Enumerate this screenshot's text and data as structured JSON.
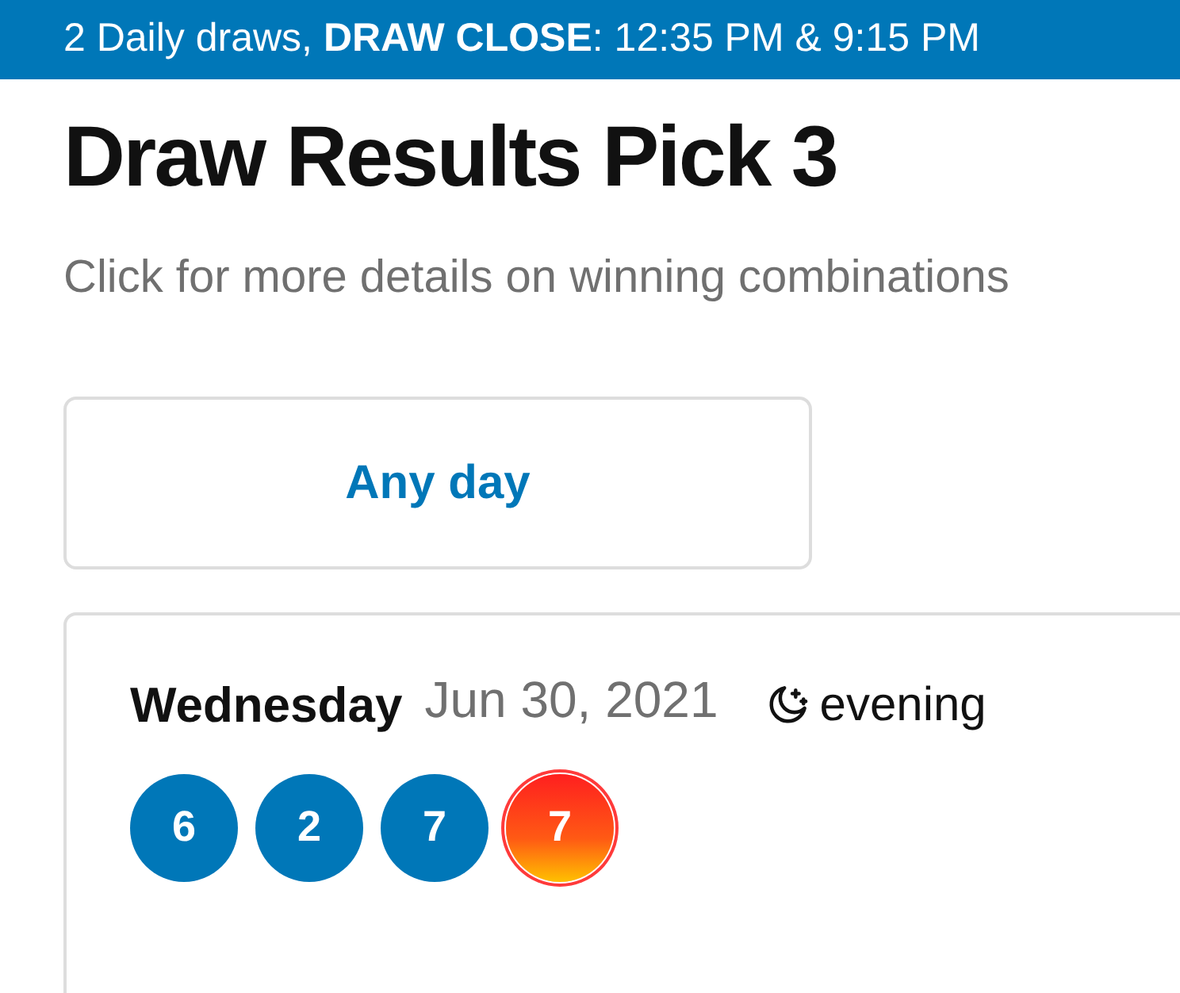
{
  "banner": {
    "text": "2 Daily draws,  **DRAW CLOSE**:  12:35 PM & 9:15 PM"
  },
  "title": "Draw Results Pick 3",
  "subtitle": "Click for more details on winning combinations",
  "filter": {
    "label": "Any day"
  },
  "result": {
    "weekday": "Wednesday",
    "date": "Jun 30, 2021",
    "period": "evening",
    "balls": [
      {
        "number": "6",
        "kind": "regular"
      },
      {
        "number": "2",
        "kind": "regular"
      },
      {
        "number": "7",
        "kind": "regular"
      },
      {
        "number": "7",
        "kind": "fireball"
      }
    ]
  }
}
